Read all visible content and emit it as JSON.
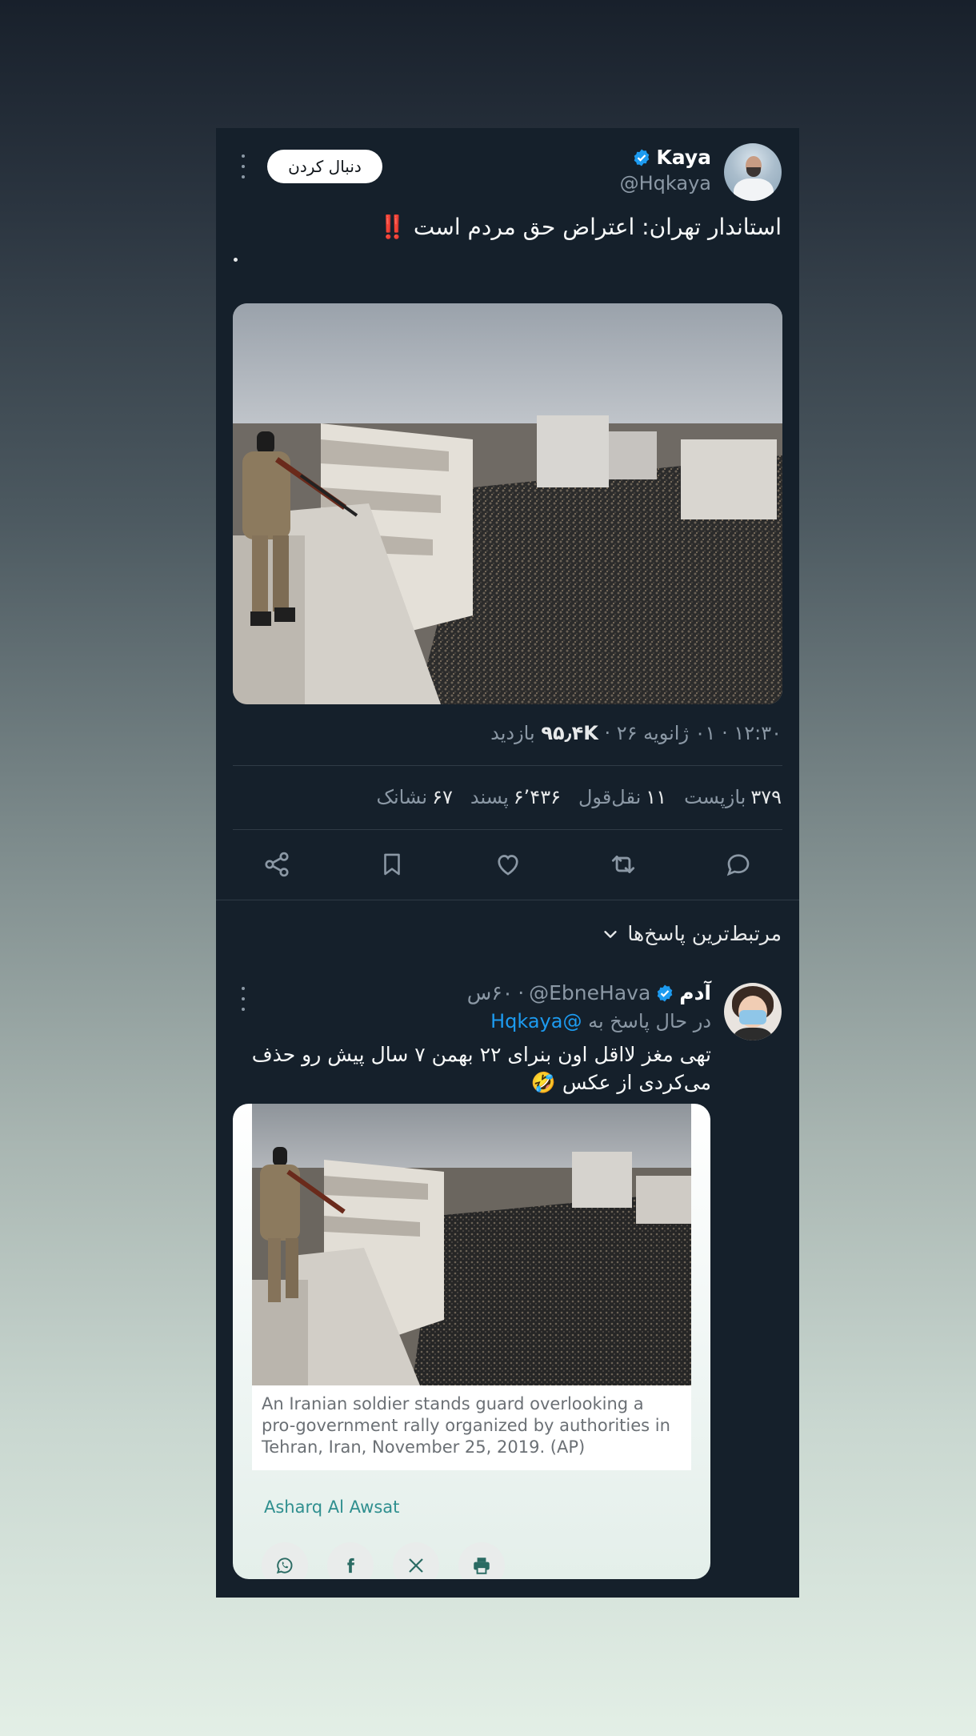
{
  "tweet": {
    "author": {
      "name": "Kaya",
      "handle": "@Hqkaya"
    },
    "follow_label": "دنبال کردن",
    "text": "استاندار تهران: اعتراض حق مردم است ‼️",
    "meta": {
      "time": "۱۲:۳۰",
      "date": "۰۱ ژانویه ۲۶",
      "views_count": "۹۵٫۴K",
      "views_label": "بازدید"
    },
    "stats": {
      "retweets": {
        "count": "۳۷۹",
        "label": "بازپست"
      },
      "quotes": {
        "count": "۱۱",
        "label": "نقل‌قول"
      },
      "likes": {
        "count": "۶٬۴۳۶",
        "label": "پسند"
      },
      "bookmarks": {
        "count": "۶۷",
        "label": "نشانک"
      }
    }
  },
  "sort_label": "مرتبط‌ترین پاسخ‌ها",
  "reply": {
    "name": "آدم",
    "handle": "@EbneHava",
    "time": "۶۰س",
    "replying_to_label": "در حال پاسخ به",
    "replying_to_handle": "@Hqkaya",
    "text": "تهی مغز لااقل اون بنرای ۲۲ بهمن ۷ سال پیش رو حذف می‌کردی از عکس 🤣",
    "card": {
      "caption": "An Iranian soldier stands guard overlooking a pro-government rally organized by authorities in Tehran, Iran, November 25, 2019. (AP)",
      "source": "Asharq Al Awsat"
    }
  },
  "colors": {
    "card_bg": "#15202b",
    "accent": "#1d9bf0",
    "muted": "#8b98a5"
  }
}
